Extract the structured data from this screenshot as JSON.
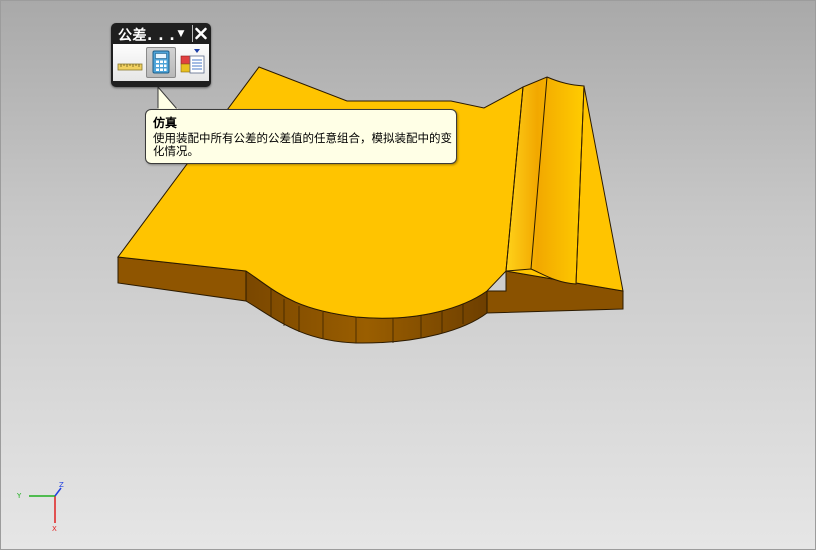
{
  "toolbar": {
    "title": "公差. . .",
    "menu_icon": "dropdown-arrow-icon",
    "close_icon": "close-icon",
    "buttons": [
      {
        "name": "tolerance-analysis-button",
        "icon": "ruler-icon",
        "active": false
      },
      {
        "name": "simulation-button",
        "icon": "calculator-icon",
        "active": true
      },
      {
        "name": "report-button",
        "icon": "report-icon",
        "active": false
      }
    ]
  },
  "tooltip": {
    "title": "仿真",
    "text": "使用装配中所有公差的公差值的任意组合，模拟装配中的变化情况。"
  },
  "triad": {
    "x_label": "X",
    "y_label": "Y",
    "z_label": "Z"
  },
  "colors": {
    "part_top": "#ffc400",
    "part_side": "#8a5200",
    "background_top": "#a9a9a9",
    "background_bottom": "#e6e6e6"
  }
}
